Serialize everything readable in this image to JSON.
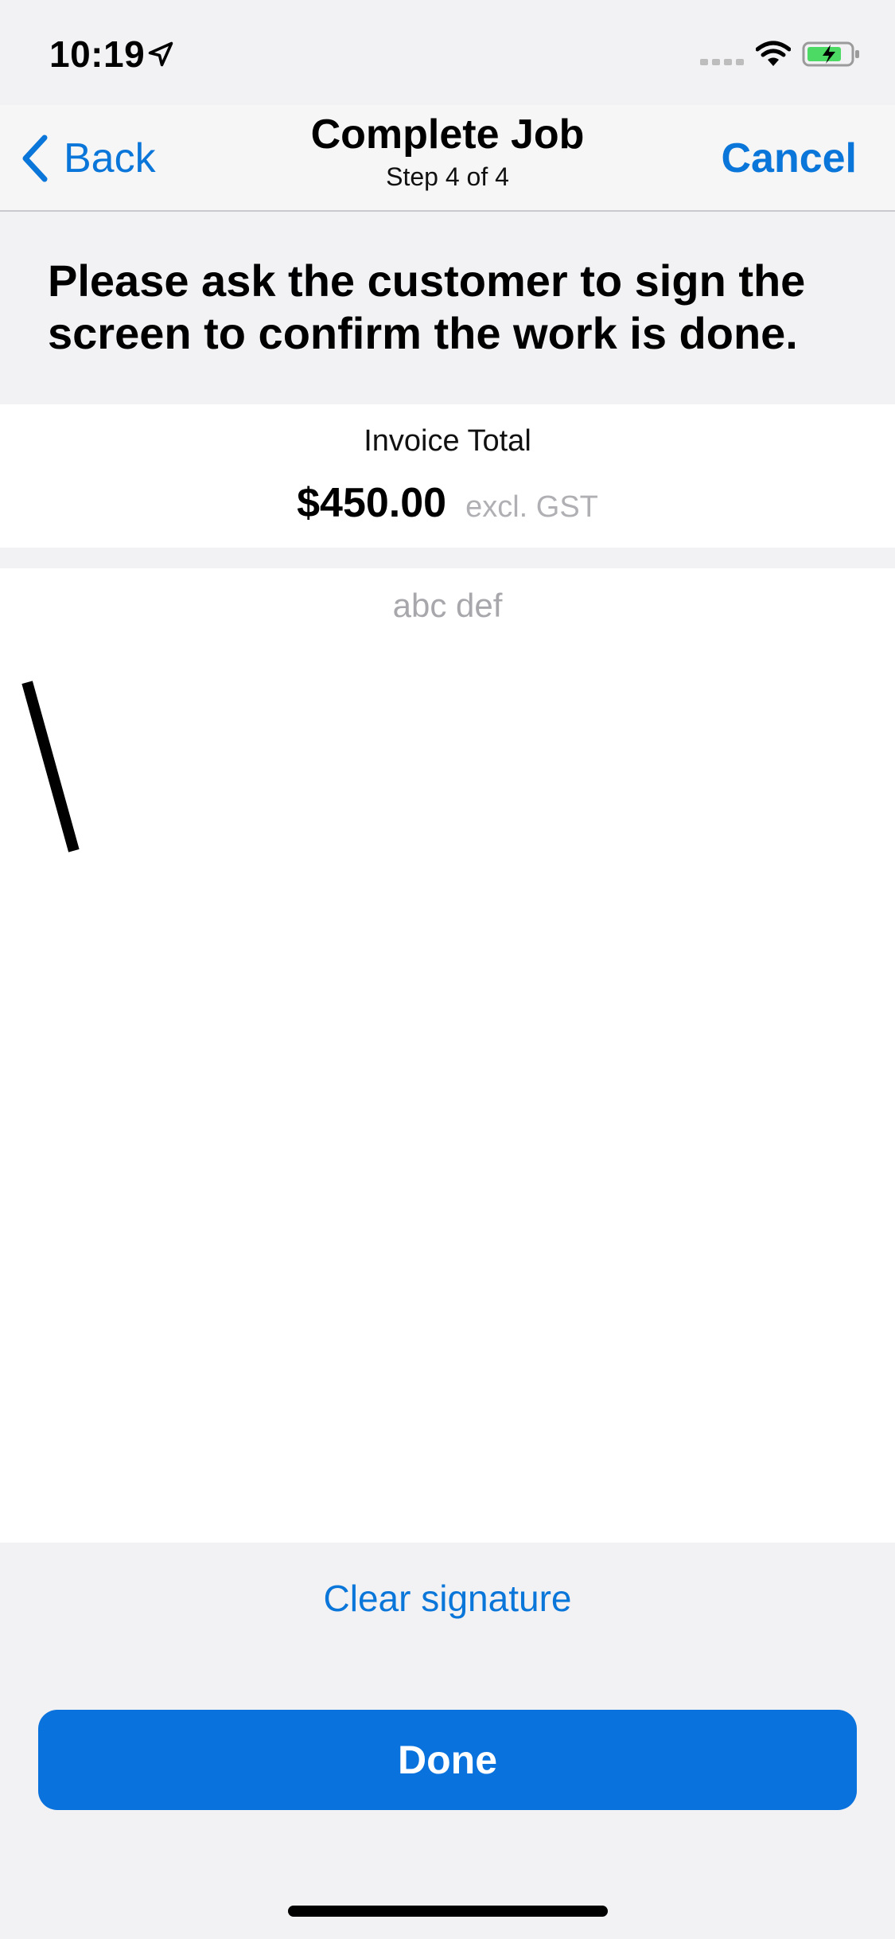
{
  "status_bar": {
    "time": "10:19",
    "icons": [
      "location-arrow-icon",
      "cellular-signal-icon",
      "wifi-icon",
      "battery-charging-icon"
    ]
  },
  "nav": {
    "back_label": "Back",
    "title": "Complete Job",
    "subtitle": "Step 4 of 4",
    "cancel_label": "Cancel"
  },
  "instruction": "Please ask the customer to sign the screen to confirm the work is done.",
  "invoice": {
    "label": "Invoice Total",
    "amount": "$450.00",
    "tax_note": "excl. GST"
  },
  "signature": {
    "signer_name": "abc def"
  },
  "actions": {
    "clear_label": "Clear signature",
    "done_label": "Done"
  },
  "colors": {
    "accent": "#0a76d9",
    "button": "#0a72dc",
    "background": "#f2f2f4"
  }
}
